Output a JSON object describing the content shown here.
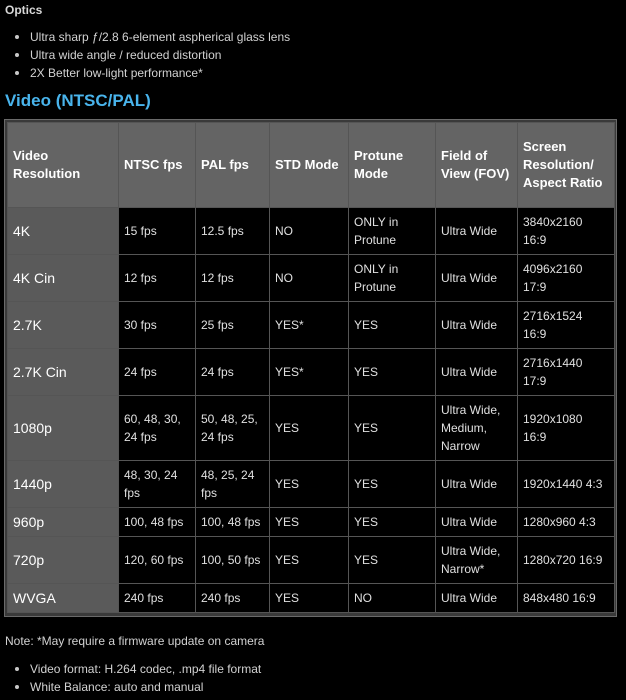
{
  "optics": {
    "title": "Optics",
    "items": [
      "Ultra sharp ƒ/2.8 6-element aspherical glass lens",
      "Ultra wide angle / reduced distortion",
      "2X Better low-light performance*"
    ]
  },
  "video": {
    "heading": "Video (NTSC/PAL)",
    "headers": [
      "Video Resolution",
      "NTSC fps",
      "PAL fps",
      "STD Mode",
      "Protune Mode",
      "Field of View (FOV)",
      "Screen Resolution/ Aspect Ratio"
    ],
    "rows": [
      [
        "4K",
        "15 fps",
        "12.5 fps",
        "NO",
        "ONLY in Protune",
        "Ultra Wide",
        "3840x2160 16:9"
      ],
      [
        "4K Cin",
        "12 fps",
        "12 fps",
        "NO",
        "ONLY in Protune",
        "Ultra Wide",
        "4096x2160 17:9"
      ],
      [
        "2.7K",
        "30 fps",
        "25 fps",
        "YES*",
        "YES",
        "Ultra Wide",
        "2716x1524 16:9"
      ],
      [
        "2.7K Cin",
        "24 fps",
        "24 fps",
        "YES*",
        "YES",
        "Ultra Wide",
        "2716x1440 17:9"
      ],
      [
        "1080p",
        "60, 48, 30, 24 fps",
        "50, 48, 25, 24 fps",
        "YES",
        "YES",
        "Ultra Wide, Medium, Narrow",
        "1920x1080 16:9"
      ],
      [
        "1440p",
        "48, 30, 24 fps",
        "48, 25, 24 fps",
        "YES",
        "YES",
        "Ultra Wide",
        "1920x1440 4:3"
      ],
      [
        "960p",
        "100, 48 fps",
        "100, 48 fps",
        "YES",
        "YES",
        "Ultra Wide",
        "1280x960 4:3"
      ],
      [
        "720p",
        "120, 60 fps",
        "100, 50 fps",
        "YES",
        "YES",
        "Ultra Wide, Narrow*",
        "1280x720 16:9"
      ],
      [
        "WVGA",
        "240 fps",
        "240 fps",
        "YES",
        "NO",
        "Ultra Wide",
        "848x480 16:9"
      ]
    ]
  },
  "note": "Note: *May require a firmware update on camera",
  "footer_items": [
    "Video format: H.264 codec, .mp4 file format",
    "White Balance: auto and manual"
  ],
  "colors": {
    "background": "#000000",
    "heading_accent": "#49b4ec",
    "header_cell": "#646464",
    "resolution_cell": "#5a5a5a"
  }
}
